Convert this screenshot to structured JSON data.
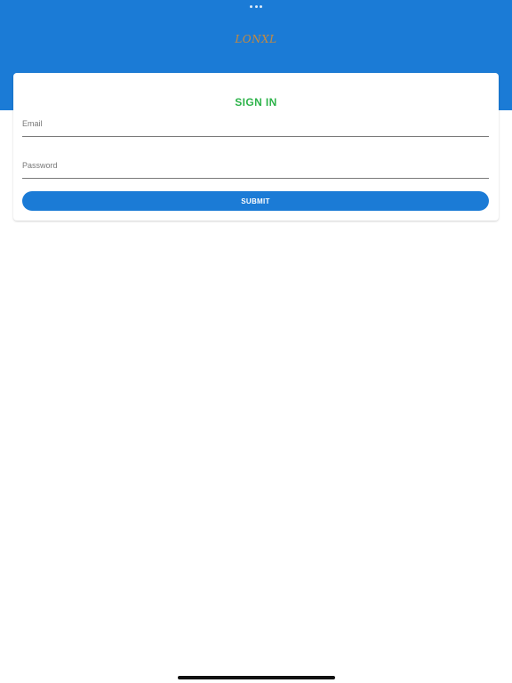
{
  "header": {
    "logo_text": "LONXL"
  },
  "signin": {
    "title": "SIGN IN",
    "email_placeholder": "Email",
    "email_value": "",
    "password_placeholder": "Password",
    "password_value": "",
    "submit_label": "SUBMIT"
  },
  "colors": {
    "header_blue": "#1b7bd6",
    "title_green": "#2db34a",
    "logo_gold": "#c98a3c"
  }
}
